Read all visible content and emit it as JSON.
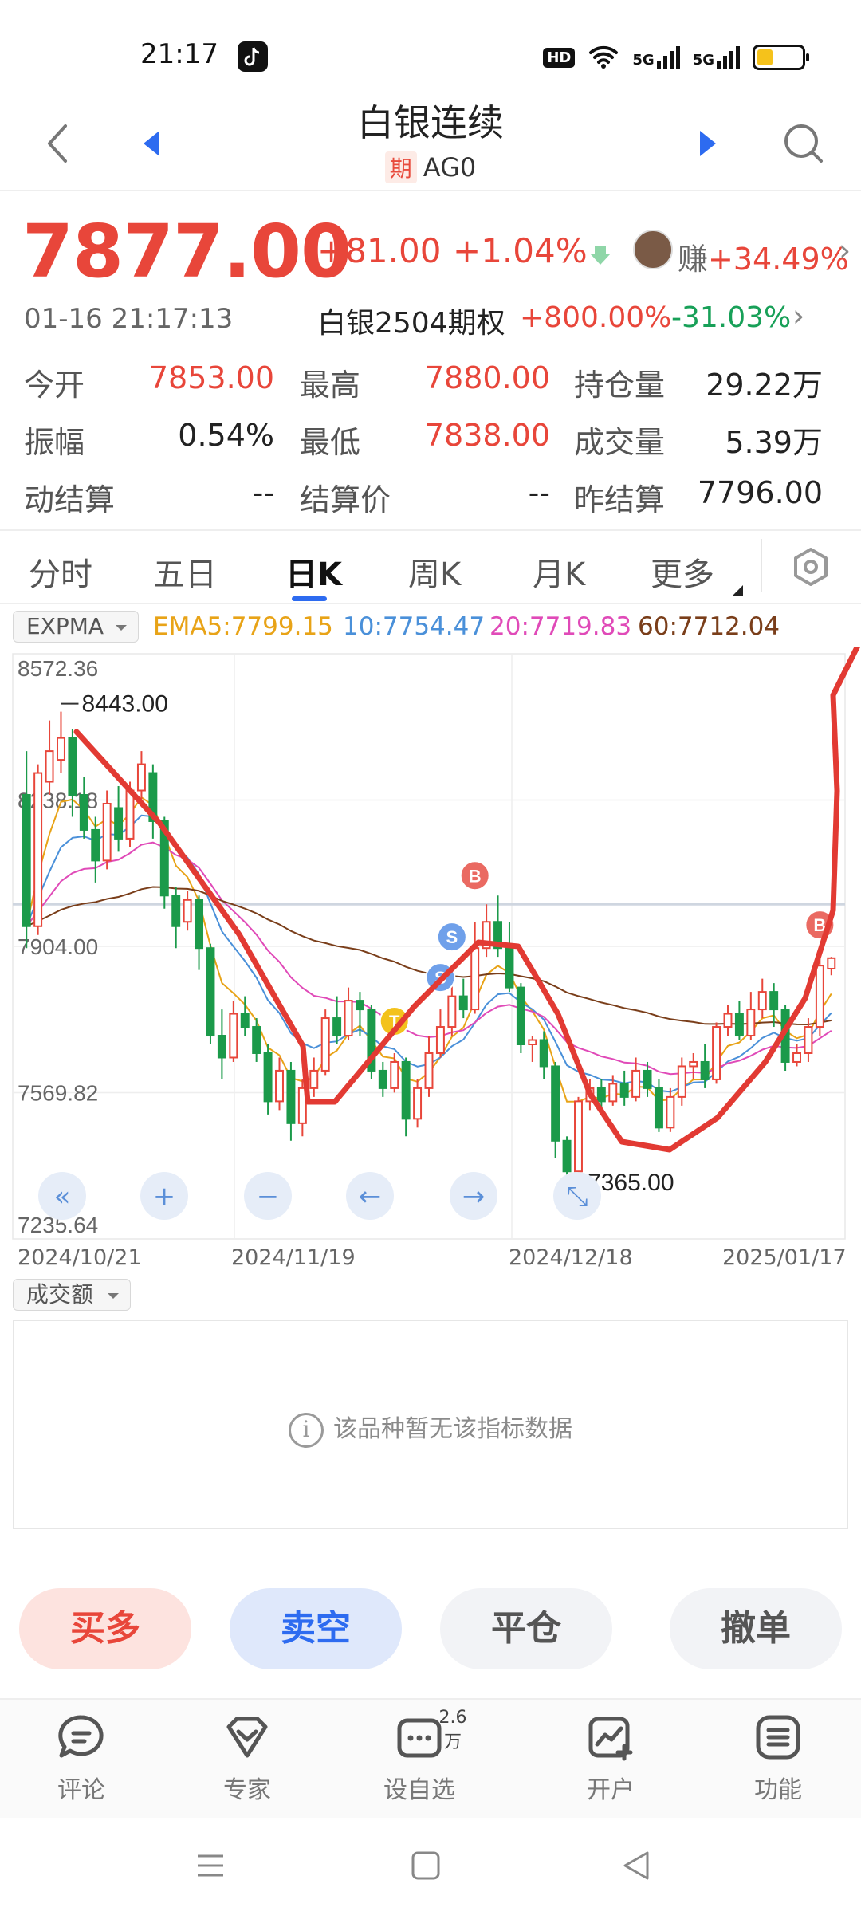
{
  "status_bar": {
    "time": "21:17",
    "hd": "HD",
    "net1": "5G",
    "net2": "5G",
    "battery_level": 0.35,
    "battery_color": "#f5c21b"
  },
  "header": {
    "title": "白银连续",
    "badge": "期",
    "code": "AG0"
  },
  "quote": {
    "price": "7877.00",
    "change_abs": "+81.00",
    "change_pct": "+1.04%",
    "earn_label": "赚",
    "earn_value": "+34.49%",
    "datetime": "01-16 21:17:13",
    "option_name": "白银2504期权",
    "option_up": "+800.00%",
    "option_down": "-31.03%"
  },
  "stats": [
    [
      {
        "label": "今开",
        "value": "7853.00",
        "color": "red"
      },
      {
        "label": "最高",
        "value": "7880.00",
        "color": "red"
      },
      {
        "label": "持仓量",
        "value": "29.22万",
        "color": "dark"
      }
    ],
    [
      {
        "label": "振幅",
        "value": "0.54%",
        "color": "dark"
      },
      {
        "label": "最低",
        "value": "7838.00",
        "color": "red"
      },
      {
        "label": "成交量",
        "value": "5.39万",
        "color": "dark"
      }
    ],
    [
      {
        "label": "动结算",
        "value": "--",
        "color": "dark"
      },
      {
        "label": "结算价",
        "value": "--",
        "color": "dark"
      },
      {
        "label": "昨结算",
        "value": "7796.00",
        "color": "dark"
      }
    ]
  ],
  "tabs": [
    "分时",
    "五日",
    "日K",
    "周K",
    "月K",
    "更多"
  ],
  "active_tab": "日K",
  "indicator": {
    "name": "EXPMA",
    "ema5": "EMA5:7799.15",
    "ema10": "10:7754.47",
    "ema20": "20:7719.83",
    "ema60": "60:7712.04",
    "colors": {
      "ema5": "#e8a317",
      "ema10": "#4a90d9",
      "ema20": "#e04ab8",
      "ema60": "#7a3e1a"
    }
  },
  "chart_data": {
    "type": "candlestick",
    "ylim": [
      7235.64,
      8572.36
    ],
    "y_ticks": [
      "8572.36",
      "8238.18",
      "7904.00",
      "7569.82",
      "7235.64"
    ],
    "x_ticks": [
      "2024/10/21",
      "2024/11/19",
      "2024/12/18",
      "2025/01/17"
    ],
    "high_marker": "8443.00",
    "low_marker": "7365.00",
    "reference_line": 8000,
    "signals": [
      {
        "label": "S",
        "index": 37,
        "color": "#6fa0ea"
      },
      {
        "label": "B",
        "index": 39,
        "color": "#ea6a62"
      },
      {
        "label": "T",
        "index": 32,
        "color": "#f3c21c"
      },
      {
        "label": "S",
        "index": 36,
        "color": "#6fa0ea"
      },
      {
        "label": "B",
        "index": 69,
        "color": "#ea6a62"
      }
    ],
    "candles": [
      [
        8250,
        7950,
        8350,
        7900
      ],
      [
        7950,
        8300,
        8320,
        7930
      ],
      [
        8280,
        8350,
        8420,
        8250
      ],
      [
        8330,
        8380,
        8440,
        8300
      ],
      [
        8380,
        8250,
        8400,
        8200
      ],
      [
        8250,
        8170,
        8290,
        8150
      ],
      [
        8170,
        8100,
        8200,
        8050
      ],
      [
        8100,
        8230,
        8260,
        8080
      ],
      [
        8220,
        8150,
        8270,
        8120
      ],
      [
        8150,
        8260,
        8280,
        8130
      ],
      [
        8260,
        8320,
        8350,
        8240
      ],
      [
        8300,
        8190,
        8320,
        8150
      ],
      [
        8190,
        8020,
        8200,
        7990
      ],
      [
        8020,
        7950,
        8040,
        7900
      ],
      [
        7960,
        8010,
        8030,
        7940
      ],
      [
        8010,
        7900,
        8020,
        7850
      ],
      [
        7900,
        7700,
        7910,
        7680
      ],
      [
        7700,
        7650,
        7760,
        7600
      ],
      [
        7650,
        7750,
        7780,
        7640
      ],
      [
        7750,
        7720,
        7790,
        7700
      ],
      [
        7720,
        7660,
        7740,
        7640
      ],
      [
        7660,
        7550,
        7680,
        7520
      ],
      [
        7550,
        7620,
        7650,
        7530
      ],
      [
        7620,
        7500,
        7640,
        7460
      ],
      [
        7500,
        7580,
        7600,
        7470
      ],
      [
        7580,
        7620,
        7650,
        7560
      ],
      [
        7620,
        7740,
        7760,
        7610
      ],
      [
        7740,
        7700,
        7790,
        7680
      ],
      [
        7700,
        7780,
        7810,
        7690
      ],
      [
        7780,
        7760,
        7800,
        7700
      ],
      [
        7760,
        7620,
        7770,
        7600
      ],
      [
        7620,
        7580,
        7640,
        7560
      ],
      [
        7580,
        7640,
        7660,
        7570
      ],
      [
        7640,
        7510,
        7650,
        7470
      ],
      [
        7510,
        7580,
        7600,
        7490
      ],
      [
        7580,
        7660,
        7700,
        7560
      ],
      [
        7660,
        7720,
        7760,
        7650
      ],
      [
        7720,
        7790,
        7820,
        7700
      ],
      [
        7790,
        7760,
        7830,
        7740
      ],
      [
        7760,
        7900,
        7960,
        7750
      ],
      [
        7900,
        7960,
        8000,
        7880
      ],
      [
        7960,
        7900,
        8020,
        7880
      ],
      [
        7900,
        7810,
        7960,
        7800
      ],
      [
        7810,
        7680,
        7820,
        7660
      ],
      [
        7680,
        7690,
        7700,
        7640
      ],
      [
        7690,
        7630,
        7710,
        7600
      ],
      [
        7630,
        7460,
        7640,
        7420
      ],
      [
        7460,
        7390,
        7470,
        7365
      ],
      [
        7390,
        7550,
        7560,
        7380
      ],
      [
        7550,
        7580,
        7600,
        7530
      ],
      [
        7580,
        7550,
        7600,
        7520
      ],
      [
        7550,
        7590,
        7610,
        7540
      ],
      [
        7590,
        7560,
        7620,
        7540
      ],
      [
        7560,
        7620,
        7650,
        7550
      ],
      [
        7620,
        7580,
        7640,
        7560
      ],
      [
        7580,
        7490,
        7600,
        7480
      ],
      [
        7490,
        7560,
        7580,
        7480
      ],
      [
        7560,
        7630,
        7650,
        7540
      ],
      [
        7630,
        7640,
        7660,
        7600
      ],
      [
        7640,
        7600,
        7680,
        7580
      ],
      [
        7600,
        7720,
        7730,
        7590
      ],
      [
        7720,
        7750,
        7770,
        7700
      ],
      [
        7750,
        7700,
        7780,
        7690
      ],
      [
        7700,
        7760,
        7800,
        7690
      ],
      [
        7760,
        7800,
        7830,
        7740
      ],
      [
        7800,
        7760,
        7820,
        7720
      ],
      [
        7760,
        7640,
        7770,
        7620
      ],
      [
        7640,
        7660,
        7680,
        7630
      ],
      [
        7660,
        7720,
        7740,
        7640
      ],
      [
        7720,
        7860,
        7880,
        7700
      ],
      [
        7853,
        7877,
        7880,
        7838
      ]
    ]
  },
  "controls": [
    "«",
    "+",
    "−",
    "←",
    "→",
    "⤡"
  ],
  "volume": {
    "name": "成交额",
    "empty_text": "该品种暂无该指标数据"
  },
  "trade": {
    "buy": "买多",
    "sell": "卖空",
    "close": "平仓",
    "cancel": "撤单"
  },
  "bottom_nav": [
    {
      "label": "评论",
      "icon": "comment-icon"
    },
    {
      "label": "专家",
      "icon": "expert-icon"
    },
    {
      "label": "设自选",
      "icon": "watchlist-icon",
      "badge": "2.6万"
    },
    {
      "label": "开户",
      "icon": "open-account-icon"
    },
    {
      "label": "功能",
      "icon": "menu-icon"
    }
  ]
}
